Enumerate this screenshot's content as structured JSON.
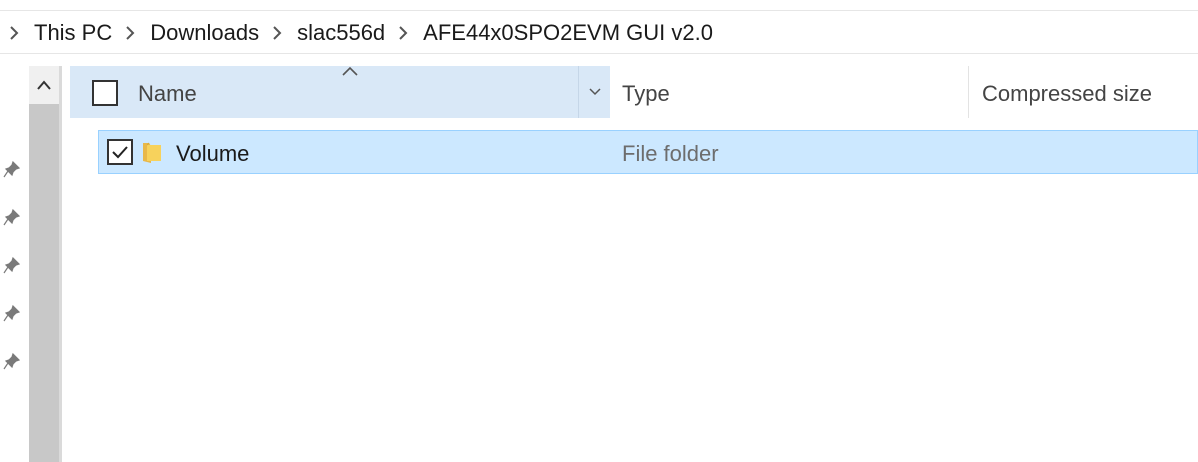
{
  "breadcrumb": {
    "items": [
      "This PC",
      "Downloads",
      "slac556d",
      "AFE44x0SPO2EVM GUI v2.0"
    ]
  },
  "columns": {
    "name": "Name",
    "type": "Type",
    "compressed_size": "Compressed size"
  },
  "rows": [
    {
      "name": "Volume",
      "type": "File folder",
      "selected": true
    }
  ],
  "colors": {
    "selection_bg": "#cce8ff",
    "header_active_bg": "#d9e8f7",
    "folder_yellow": "#f7d25c"
  }
}
